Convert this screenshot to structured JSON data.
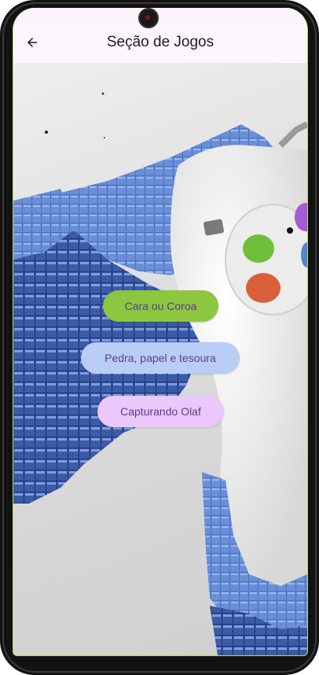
{
  "appbar": {
    "title": "Seção de Jogos",
    "back_icon": "arrow-left-icon"
  },
  "menu": {
    "buttons": [
      {
        "label": "Cara ou Coroa",
        "color": "#8dc63f"
      },
      {
        "label": "Pedra, papel e tesoura",
        "color": "#b9cdf6"
      },
      {
        "label": "Capturando Olaf",
        "color": "#ecc7fb"
      }
    ]
  },
  "background": {
    "description_icon": "gamepad-voxel-illustration",
    "colors": {
      "voxel": "#4a6fc0",
      "controller": "#f2f2f2",
      "button_green": "#6fbf3a",
      "button_red": "#d85f3a",
      "button_purple": "#a65ad6"
    }
  }
}
